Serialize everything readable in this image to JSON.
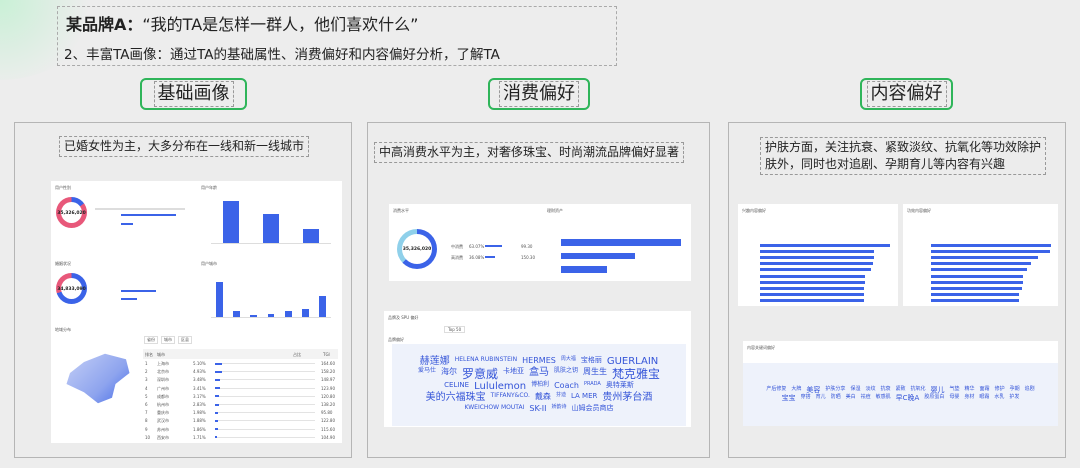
{
  "header": {
    "brand": "某品牌A：",
    "quote": "“我的TA是怎样一群人，他们喜欢什么”",
    "subtitle": "2、丰富TA画像：通过TA的基础属性、消费偏好和内容偏好分析，了解TA"
  },
  "sections": [
    {
      "label": "基础画像",
      "note": "已婚女性为主，大多分布在一线和新一线城市"
    },
    {
      "label": "消费偏好",
      "note": "中高消费水平为主，对奢侈珠宝、时尚潮流品牌偏好显著"
    },
    {
      "label": "内容偏好",
      "note": "护肤方面，关注抗衰、紧致淡纹、抗氧化等功效除护肤外，同时也对追剧、孕期育儿等内容有兴趣"
    }
  ],
  "basic": {
    "gender": {
      "title": "用户性别",
      "total": "35,326,020",
      "share_female": 0.85
    },
    "age_title": "用户年龄",
    "age_values": [
      90,
      62,
      30
    ],
    "marital": {
      "title": "婚姻状况",
      "total": "34,833,090",
      "share_married": 0.7
    },
    "city_level_title": "用户城市",
    "city_values": [
      85,
      15,
      4,
      7,
      14,
      20,
      52
    ],
    "region": {
      "title": "地域分布",
      "tabs": [
        "省份",
        "城市",
        "区县"
      ],
      "cols": [
        "排名",
        "城市",
        "占比",
        "TGI"
      ],
      "rows": [
        [
          "1",
          "上海市",
          "5.10%",
          "164.60"
        ],
        [
          "2",
          "北京市",
          "4.93%",
          "158.20"
        ],
        [
          "3",
          "深圳市",
          "3.48%",
          "148.97"
        ],
        [
          "4",
          "广州市",
          "3.41%",
          "123.90"
        ],
        [
          "5",
          "成都市",
          "3.17%",
          "120.80"
        ],
        [
          "6",
          "杭州市",
          "2.83%",
          "138.20"
        ],
        [
          "7",
          "重庆市",
          "1.98%",
          "95.80"
        ],
        [
          "8",
          "武汉市",
          "1.88%",
          "122.80"
        ],
        [
          "9",
          "苏州市",
          "1.86%",
          "115.60"
        ],
        [
          "10",
          "西安市",
          "1.71%",
          "104.90"
        ]
      ]
    }
  },
  "consume": {
    "level": {
      "title": "消费水平",
      "total": "35,326,020",
      "share_high": 0.63,
      "rows": [
        [
          "中消费",
          "63.07%",
          "99.30"
        ],
        [
          "高消费",
          "36.08%",
          "150.30"
        ]
      ]
    },
    "asset_title": "理财资产",
    "asset_values": [
      100,
      62,
      38
    ],
    "brand": {
      "title": "品牌及 SPU 偏好",
      "sub": "品牌偏好",
      "filter": "Top 50",
      "words": [
        "赫莲娜",
        "HELENA RUBINSTEIN",
        "HERMES",
        "周大福",
        "宝格丽",
        "GUERLAIN",
        "爱马仕",
        "海尔",
        "罗意威",
        "卡地亚",
        "盒马",
        "肌肤之钥",
        "周生生",
        "梵克雅宝",
        "CELINE",
        "Lululemon",
        "博柏利",
        "Coach",
        "PRADA",
        "奥特莱斯",
        "美的六福珠宝",
        "TIFFANY&CO.",
        "戴森",
        "芬迪",
        "LA MER",
        "贵州茅台酒",
        "KWEICHOW MOUTAI",
        "SK-II",
        "娇韵诗",
        "山姆会员商店"
      ]
    }
  },
  "content": {
    "interest_title": "兴趣内容偏好",
    "interest_values": [
      100,
      88,
      88,
      87,
      85,
      81,
      81,
      80,
      80,
      80
    ],
    "effect_title": "功效内容偏好",
    "effect_values": [
      100,
      99,
      89,
      83,
      80,
      77,
      77,
      76,
      73,
      73
    ],
    "keywords": {
      "title": "内容关键词偏好",
      "words": [
        "产后修复",
        "大牌",
        "美容",
        "护肤分享",
        "保湿",
        "淡纹",
        "抗衰",
        "紧致",
        "抗氧化",
        "婴儿",
        "气垫",
        "精华",
        "面霜",
        "修护",
        "孕期",
        "追剧",
        "宝宝",
        "穿搭",
        "育儿",
        "防晒",
        "美白",
        "祛痘",
        "敏感肌",
        "早C晚A",
        "胶原蛋白",
        "母婴",
        "身材",
        "眼霜",
        "水乳",
        "护发"
      ]
    }
  }
}
